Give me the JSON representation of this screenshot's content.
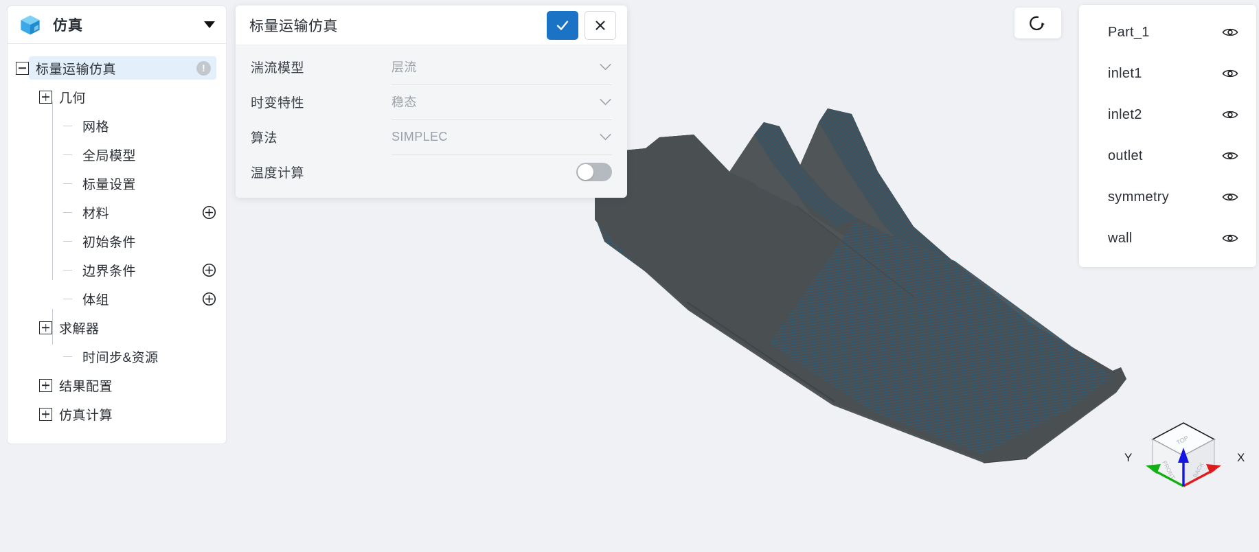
{
  "app": {
    "title": "仿真",
    "logo_icon": "blue-cube-icon",
    "collapse_icon": "caret-down-icon"
  },
  "sidebar": {
    "tree": [
      {
        "label": "标量运输仿真",
        "toggle": "minus",
        "depth": 0,
        "selected": true,
        "badge": "!",
        "action": null
      },
      {
        "label": "几何",
        "toggle": "plus",
        "depth": 1,
        "selected": false,
        "badge": null,
        "action": null
      },
      {
        "label": "网格",
        "toggle": "stub",
        "depth": 2,
        "selected": false,
        "badge": null,
        "action": null
      },
      {
        "label": "全局模型",
        "toggle": "stub",
        "depth": 2,
        "selected": false,
        "badge": null,
        "action": null
      },
      {
        "label": "标量设置",
        "toggle": "stub",
        "depth": 2,
        "selected": false,
        "badge": null,
        "action": null
      },
      {
        "label": "材料",
        "toggle": "stub",
        "depth": 2,
        "selected": false,
        "badge": null,
        "action": "plus-circle"
      },
      {
        "label": "初始条件",
        "toggle": "stub",
        "depth": 2,
        "selected": false,
        "badge": null,
        "action": null
      },
      {
        "label": "边界条件",
        "toggle": "stub",
        "depth": 2,
        "selected": false,
        "badge": null,
        "action": "plus-circle"
      },
      {
        "label": "体组",
        "toggle": "stub",
        "depth": 2,
        "selected": false,
        "badge": null,
        "action": "plus-circle"
      },
      {
        "label": "求解器",
        "toggle": "plus",
        "depth": 1,
        "selected": false,
        "badge": null,
        "action": null
      },
      {
        "label": "时间步&资源",
        "toggle": "stub",
        "depth": 2,
        "selected": false,
        "badge": null,
        "action": null
      },
      {
        "label": "结果配置",
        "toggle": "plus",
        "depth": 1,
        "selected": false,
        "badge": null,
        "action": null
      },
      {
        "label": "仿真计算",
        "toggle": "plus",
        "depth": 1,
        "selected": false,
        "badge": null,
        "action": null
      }
    ]
  },
  "dialog": {
    "title": "标量运输仿真",
    "confirm_icon": "check-icon",
    "cancel_icon": "close-icon",
    "confirm_color": "#1a73c4",
    "rows": [
      {
        "label": "湍流模型",
        "value": "层流",
        "control": "select",
        "icon": "chevron-down-icon"
      },
      {
        "label": "时变特性",
        "value": "稳态",
        "control": "select",
        "icon": "chevron-down-icon"
      },
      {
        "label": "算法",
        "value": "SIMPLEC",
        "control": "select",
        "icon": "chevron-down-icon"
      },
      {
        "label": "温度计算",
        "value": "",
        "control": "toggle",
        "toggle_on": false
      }
    ]
  },
  "parts_panel": {
    "items": [
      {
        "name": "Part_1",
        "visibility_icon": "eye-icon"
      },
      {
        "name": "inlet1",
        "visibility_icon": "eye-icon"
      },
      {
        "name": "inlet2",
        "visibility_icon": "eye-icon"
      },
      {
        "name": "outlet",
        "visibility_icon": "eye-icon"
      },
      {
        "name": "symmetry",
        "visibility_icon": "eye-icon"
      },
      {
        "name": "wall",
        "visibility_icon": "eye-icon"
      }
    ]
  },
  "viewport": {
    "reset_icon": "reset-view-icon",
    "model_color": "#4a4f53",
    "mesh_edge_color": "#2c5a72",
    "background_color": "#eff1f4"
  },
  "axis_triad": {
    "x_label": "X",
    "y_label": "Y",
    "x_color": "#e01b1b",
    "y_color": "#12b012",
    "z_color": "#1414e6",
    "cube_faces": [
      "TOP",
      "FRONT",
      "BACK"
    ]
  }
}
